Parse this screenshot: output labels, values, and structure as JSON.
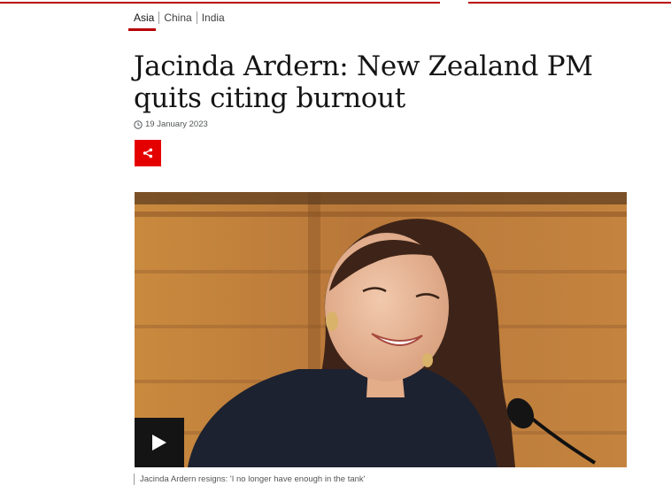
{
  "subnav": {
    "items": [
      {
        "label": "Asia",
        "active": true
      },
      {
        "label": "China",
        "active": false
      },
      {
        "label": "India",
        "active": false
      }
    ]
  },
  "article": {
    "headline": "Jacinda Ardern: New Zealand PM quits citing burnout",
    "date": "19 January 2023",
    "caption": "Jacinda Ardern resigns: 'I no longer have enough in the tank'"
  },
  "icons": {
    "clock": "clock-icon",
    "share": "share-icon",
    "play": "play-icon"
  },
  "colors": {
    "brand_red": "#b80000",
    "share_red": "#e50000",
    "play_bg": "#141414"
  }
}
